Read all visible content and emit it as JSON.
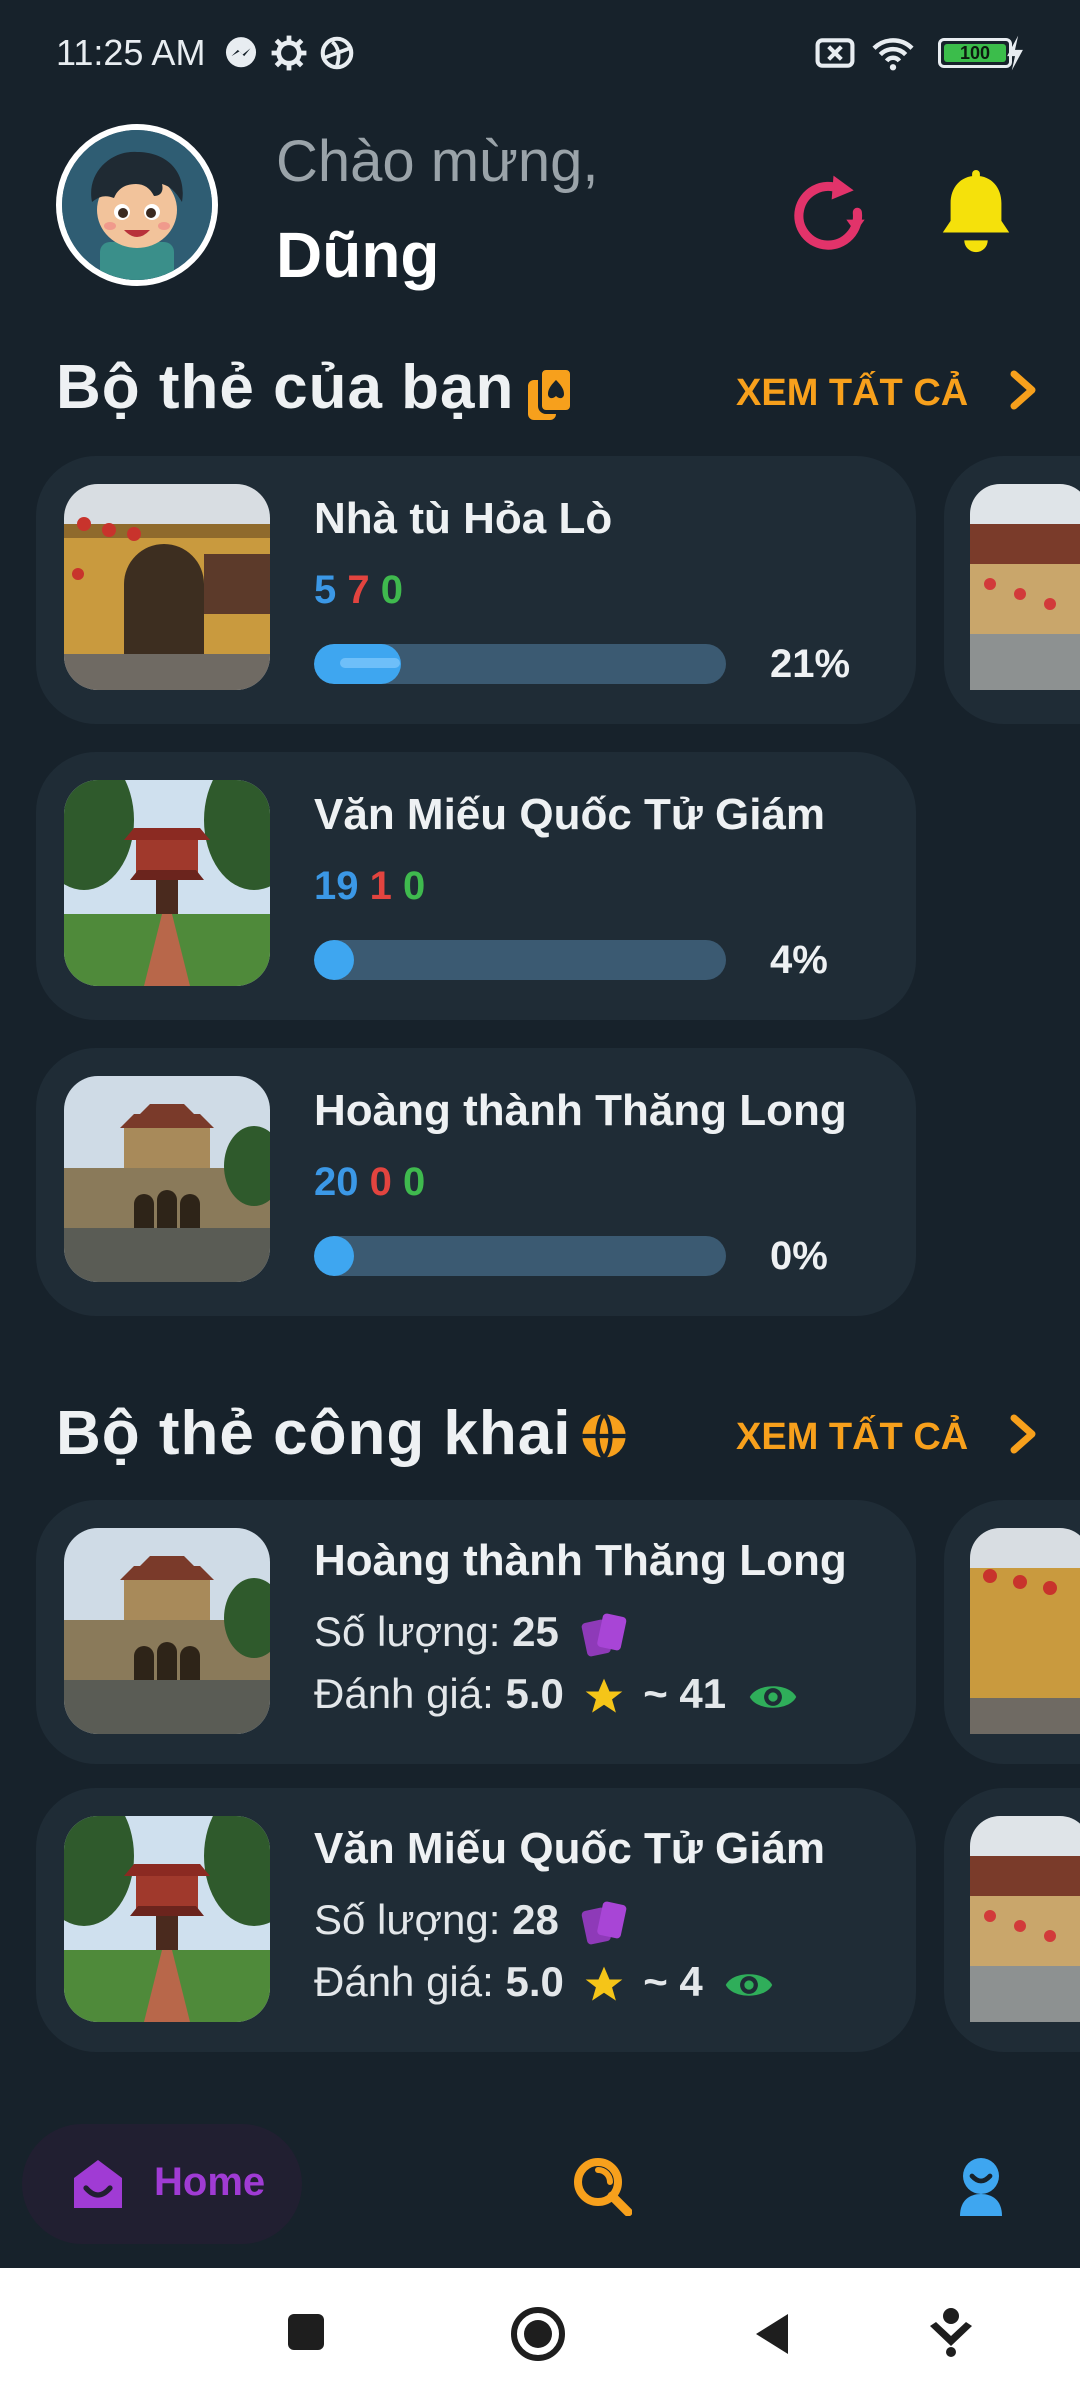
{
  "status_bar": {
    "time": "11:25 AM",
    "battery": "100"
  },
  "header": {
    "greeting": "Chào mừng,",
    "username": "Dũng"
  },
  "my_decks": {
    "title": "Bộ thẻ của bạn",
    "see_all": "XEM TẤT CẢ",
    "cards": [
      {
        "title": "Nhà tù Hỏa Lò",
        "blue": "5",
        "red": "7",
        "green": "0",
        "progress_percent": 21,
        "percent_label": "21%"
      },
      {
        "title": "Văn Miếu Quốc Tử Giám",
        "blue": "19",
        "red": "1",
        "green": "0",
        "progress_percent": 4,
        "percent_label": "4%"
      },
      {
        "title": "Hoàng thành Thăng Long",
        "blue": "20",
        "red": "0",
        "green": "0",
        "progress_percent": 0,
        "percent_label": "0%"
      }
    ]
  },
  "public_decks": {
    "title": "Bộ thẻ công khai",
    "see_all": "XEM TẤT CẢ",
    "quantity_label": "Số lượng:",
    "rating_label": "Đánh giá:",
    "cards": [
      {
        "title": "Hoàng thành Thăng Long",
        "quantity": "25",
        "rating": "5.0",
        "views": "~ 41"
      },
      {
        "title": "Văn Miếu Quốc Tử Giám",
        "quantity": "28",
        "rating": "5.0",
        "views": "~ 4"
      }
    ]
  },
  "bottom_nav": {
    "home_label": "Home"
  },
  "colors": {
    "background": "#17222b",
    "card": "#1f2c36",
    "accent_orange": "#f7a01c",
    "stat_blue": "#3b98e6",
    "stat_red": "#e2443f",
    "stat_green": "#3fba4e",
    "progress": "#3ea6f0",
    "home_purple": "#a03bd4",
    "bell_yellow": "#f5e10b",
    "refresh_pink": "#e2336a"
  }
}
